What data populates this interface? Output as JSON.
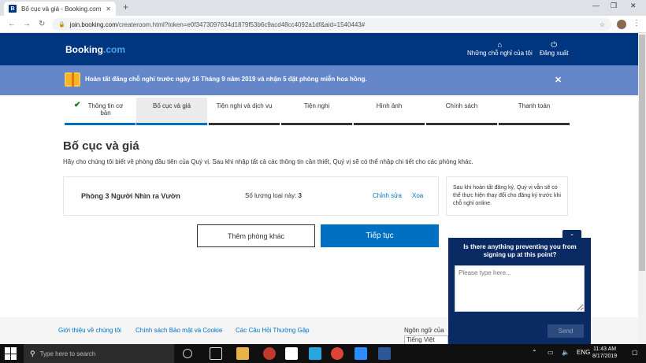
{
  "browser": {
    "tab_title": "Bố cục và giá - Booking.com",
    "tab_favicon": "B",
    "url_host": "join.booking.com",
    "url_path": "/createroom.html?token=e0f3473097634d1879f53b6c9acd48cc4092a1df&aid=1540443#",
    "back": "←",
    "forward": "→",
    "reload": "↻",
    "lock": "🔒",
    "star": "☆",
    "menu": "⋮",
    "new_tab": "+",
    "close_tab": "✕",
    "win_min": "—",
    "win_max": "❐",
    "win_close": "✕"
  },
  "header": {
    "logo_main": "Booking",
    "logo_dot": ".com",
    "links": [
      {
        "icon": "⌂",
        "label": "Những chỗ nghỉ của tôi"
      },
      {
        "icon": "⏻",
        "label": "Đăng xuất"
      }
    ]
  },
  "banner": {
    "text": "Hoàn tất đăng chỗ nghỉ trước ngày 16 Tháng 9 năm 2019 và nhận 5 đặt phòng miễn hoa hồng.",
    "close": "✕"
  },
  "steps": [
    {
      "label": "Thông tin cơ bản",
      "done": true
    },
    {
      "label": "Bố cục và giá",
      "current": true
    },
    {
      "label": "Tiện nghi và dịch vụ"
    },
    {
      "label": "Tiện nghi"
    },
    {
      "label": "Hình ảnh"
    },
    {
      "label": "Chính sách"
    },
    {
      "label": "Thanh toán"
    }
  ],
  "check_mark": "✔",
  "page": {
    "title": "Bố cục và giá",
    "subtitle": "Hãy cho chúng tôi biết về phòng đầu tiên của Quý vị. Sau khi nhập tất cả các thông tin cần thiết, Quý vị sẽ có thể nhập chi tiết cho các phòng khác."
  },
  "room": {
    "name": "Phòng 3 Người Nhìn ra Vườn",
    "count_label": "Số lượng loại này:",
    "count_value": "3",
    "edit": "Chỉnh sửa",
    "delete": "Xoa"
  },
  "note": "Sau khi hoàn tất đăng ký, Quý vị vẫn sẽ có thể thực hiện thay đổi cho đăng ký trước khi chỗ nghỉ online.",
  "buttons": {
    "add_room": "Thêm phòng khác",
    "continue": "Tiếp tục"
  },
  "footer": {
    "links": [
      "Giới thiệu về chúng tôi",
      "Chính sách Bảo mật và Cookie",
      "Các Câu Hỏi Thường Gặp"
    ],
    "language_label": "Ngôn ngữ của",
    "language_value": "Tiếng Việt"
  },
  "chat": {
    "toggle": "⌄",
    "question": "Is there anything preventing you from signing up at this point?",
    "placeholder": "Please type here...",
    "send": "Send"
  },
  "taskbar": {
    "search_placeholder": "Type here to search",
    "search_icon": "⚲",
    "tray_up": "⌃",
    "tray_battery": "▭",
    "tray_volume": "🔈",
    "lang": "ENG",
    "time": "11:43 AM",
    "date": "8/17/2019",
    "notif": "▢"
  },
  "colors": {
    "brand": "#003580",
    "banner": "#6586c8",
    "accent": "#0071c2",
    "chat": "#0a2a63"
  }
}
